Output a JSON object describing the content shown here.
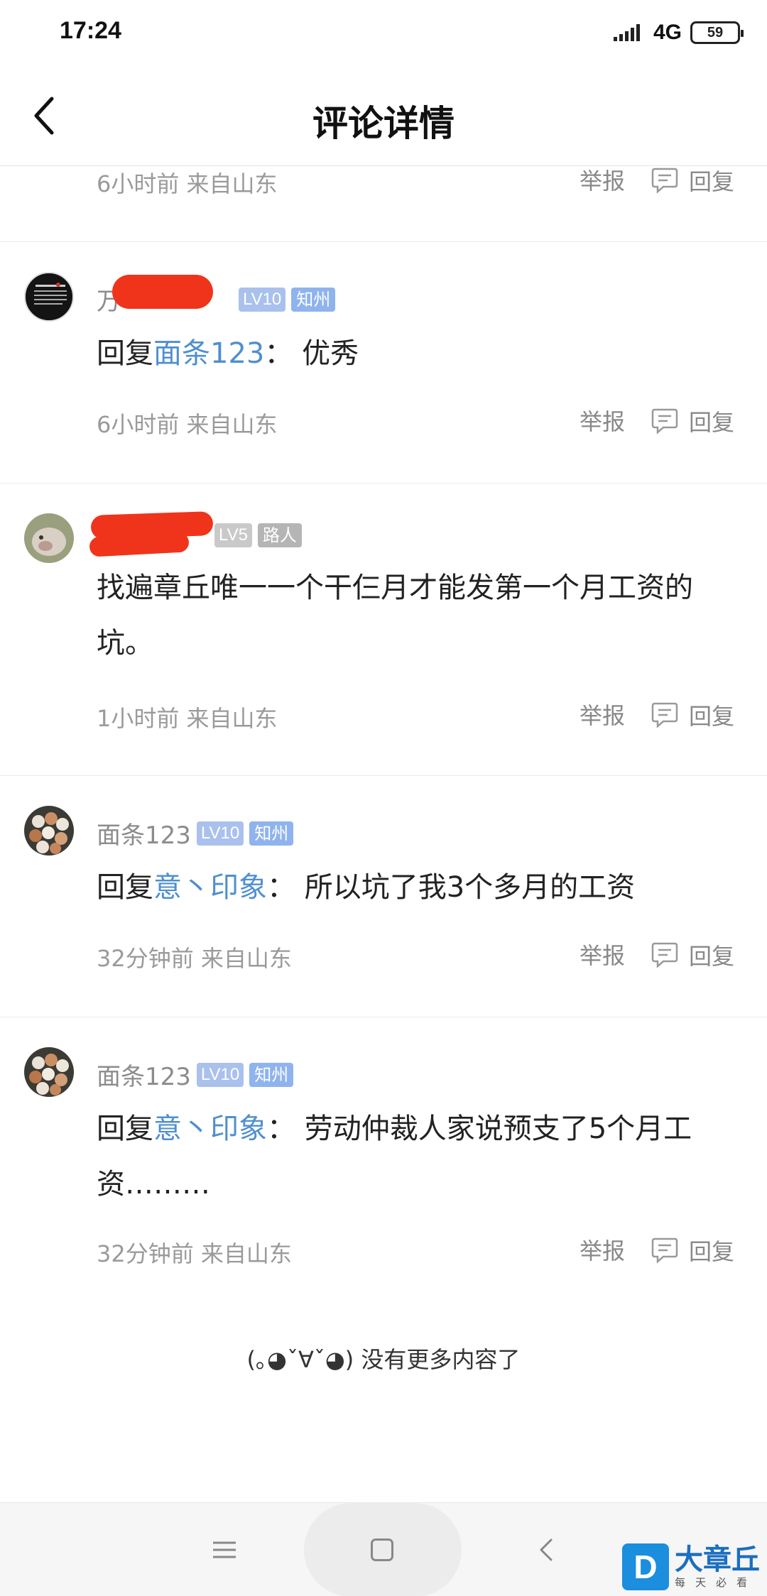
{
  "status_bar": {
    "time": "17:24",
    "network": "4G",
    "battery": "59"
  },
  "header": {
    "title": "评论详情"
  },
  "top_partial": {
    "meta": "6小时前 来自山东",
    "report": "举报",
    "reply": "回复"
  },
  "comments": [
    {
      "user": "万",
      "level": "LV10",
      "rank": "知州",
      "reply_prefix": "回复",
      "reply_to": "面条123",
      "separator": "：",
      "text": "优秀",
      "meta": "6小时前 来自山东",
      "report": "举报",
      "reply": "回复"
    },
    {
      "user": "",
      "level": "LV5",
      "rank": "路人",
      "text": "找遍章丘唯一一个干仨月才能发第一个月工资的坑。",
      "meta": "1小时前 来自山东",
      "report": "举报",
      "reply": "回复"
    },
    {
      "user": "面条123",
      "level": "LV10",
      "rank": "知州",
      "reply_prefix": "回复",
      "reply_to": "意丶印象",
      "separator": "：",
      "text": "所以坑了我3个多月的工资",
      "meta": "32分钟前 来自山东",
      "report": "举报",
      "reply": "回复"
    },
    {
      "user": "面条123",
      "level": "LV10",
      "rank": "知州",
      "reply_prefix": "回复",
      "reply_to": "意丶印象",
      "separator": "：",
      "text": "劳动仲裁人家说预支了5个月工资………",
      "meta": "32分钟前 来自山东",
      "report": "举报",
      "reply": "回复"
    }
  ],
  "end_note": "(｡◕ˇ∀ˇ◕) 没有更多内容了",
  "watermark": {
    "logo": "D",
    "title": "大章丘",
    "subtitle": "每天必看"
  },
  "icons": {
    "back": "chevron-left-icon",
    "reply": "speech-bubble-icon",
    "menu": "hamburger-icon",
    "home": "square-icon",
    "nav_back": "chevron-left-icon"
  },
  "colors": {
    "link": "#4f8fcf",
    "badge_level": "#a9c1ec",
    "badge_rank": "#8fb3ee",
    "redaction": "#f0341b"
  }
}
